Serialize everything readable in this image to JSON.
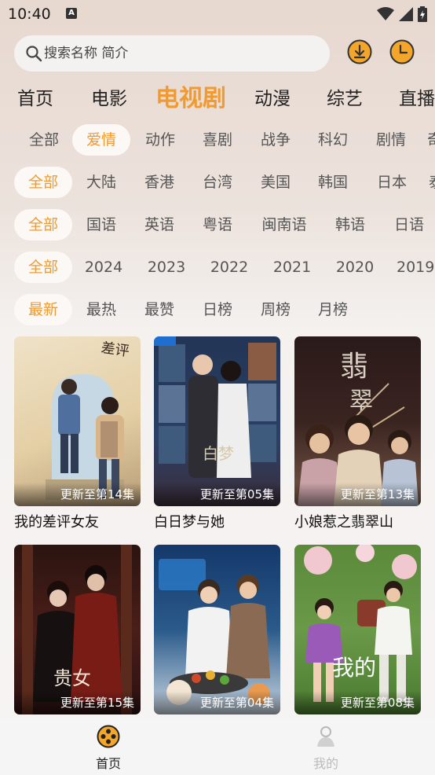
{
  "status_bar": {
    "time": "10:40",
    "notification_glyph": "A"
  },
  "search": {
    "placeholder": "搜索名称 简介",
    "download_icon": "download-icon",
    "history_icon": "history-clock-icon"
  },
  "accent_color": "#f09a30",
  "nav_tabs": [
    {
      "label": "首页",
      "active": false
    },
    {
      "label": "电影",
      "active": false
    },
    {
      "label": "电视剧",
      "active": true
    },
    {
      "label": "动漫",
      "active": false
    },
    {
      "label": "综艺",
      "active": false
    },
    {
      "label": "直播",
      "active": false
    }
  ],
  "filters": {
    "genre": [
      "全部",
      "爱情",
      "动作",
      "喜剧",
      "战争",
      "科幻",
      "剧情",
      "奇"
    ],
    "region": [
      "全部",
      "大陆",
      "香港",
      "台湾",
      "美国",
      "韩国",
      "日本",
      "泰"
    ],
    "language": [
      "全部",
      "国语",
      "英语",
      "粤语",
      "闽南语",
      "韩语",
      "日语"
    ],
    "year": [
      "全部",
      "2024",
      "2023",
      "2022",
      "2021",
      "2020",
      "2019"
    ],
    "sort": [
      "最新",
      "最热",
      "最赞",
      "日榜",
      "周榜",
      "月榜"
    ]
  },
  "selected": {
    "genre": "爱情",
    "region": "全部",
    "language": "全部",
    "year": "全部",
    "sort": "最新"
  },
  "shows": [
    {
      "title": "我的差评女友",
      "update": "更新至第14集"
    },
    {
      "title": "白日梦与她",
      "update": "更新至第05集"
    },
    {
      "title": "小娘惹之翡翠山",
      "update": "更新至第13集"
    },
    {
      "title": "",
      "update": "更新至第15集"
    },
    {
      "title": "",
      "update": "更新至第04集"
    },
    {
      "title": "",
      "update": "更新至第08集"
    }
  ],
  "bottom_nav": [
    {
      "label": "首页",
      "icon": "film-reel-icon",
      "active": true
    },
    {
      "label": "我的",
      "icon": "profile-icon",
      "active": false
    }
  ]
}
